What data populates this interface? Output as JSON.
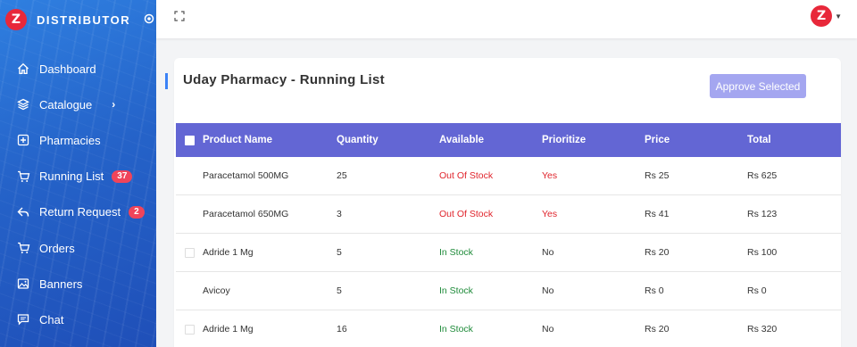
{
  "app": {
    "brand_name": "DISTRIBUTOR",
    "logo_text": "Z",
    "avatar_text": "Z"
  },
  "sidebar": {
    "items": [
      {
        "label": "Dashboard",
        "icon": "home-icon"
      },
      {
        "label": "Catalogue",
        "icon": "layers-icon",
        "chevron": "›"
      },
      {
        "label": "Pharmacies",
        "icon": "plus-square-icon"
      },
      {
        "label": "Running List",
        "icon": "cart-icon",
        "badge": "37"
      },
      {
        "label": "Return Request",
        "icon": "return-icon",
        "badge": "2"
      },
      {
        "label": "Orders",
        "icon": "cart-icon"
      },
      {
        "label": "Banners",
        "icon": "image-icon"
      },
      {
        "label": "Chat",
        "icon": "chat-icon"
      }
    ]
  },
  "page": {
    "title": "Uday Pharmacy - Running List",
    "approve_button": "Approve Selected"
  },
  "table": {
    "headers": [
      "Product Name",
      "Quantity",
      "Available",
      "Prioritize",
      "Price",
      "Total"
    ],
    "rows": [
      {
        "has_checkbox": false,
        "product": "Paracetamol 500MG",
        "quantity": "25",
        "available": "Out Of Stock",
        "prioritize": "Yes",
        "price": "Rs 25",
        "total": "Rs 625"
      },
      {
        "has_checkbox": false,
        "product": "Paracetamol 650MG",
        "quantity": "3",
        "available": "Out Of Stock",
        "prioritize": "Yes",
        "price": "Rs 41",
        "total": "Rs 123"
      },
      {
        "has_checkbox": true,
        "product": "Adride 1 Mg",
        "quantity": "5",
        "available": "In Stock",
        "prioritize": "No",
        "price": "Rs 20",
        "total": "Rs 100"
      },
      {
        "has_checkbox": false,
        "product": "Avicoy",
        "quantity": "5",
        "available": "In Stock",
        "prioritize": "No",
        "price": "Rs 0",
        "total": "Rs 0"
      },
      {
        "has_checkbox": true,
        "product": "Adride 1 Mg",
        "quantity": "16",
        "available": "In Stock",
        "prioritize": "No",
        "price": "Rs 20",
        "total": "Rs 320"
      }
    ]
  },
  "colors": {
    "sidebar": "#2563c9",
    "accent": "#6366d4",
    "button": "#a4a6f0",
    "danger": "#e0242c",
    "success": "#1f8b3a",
    "brand_red": "#e8283a"
  }
}
